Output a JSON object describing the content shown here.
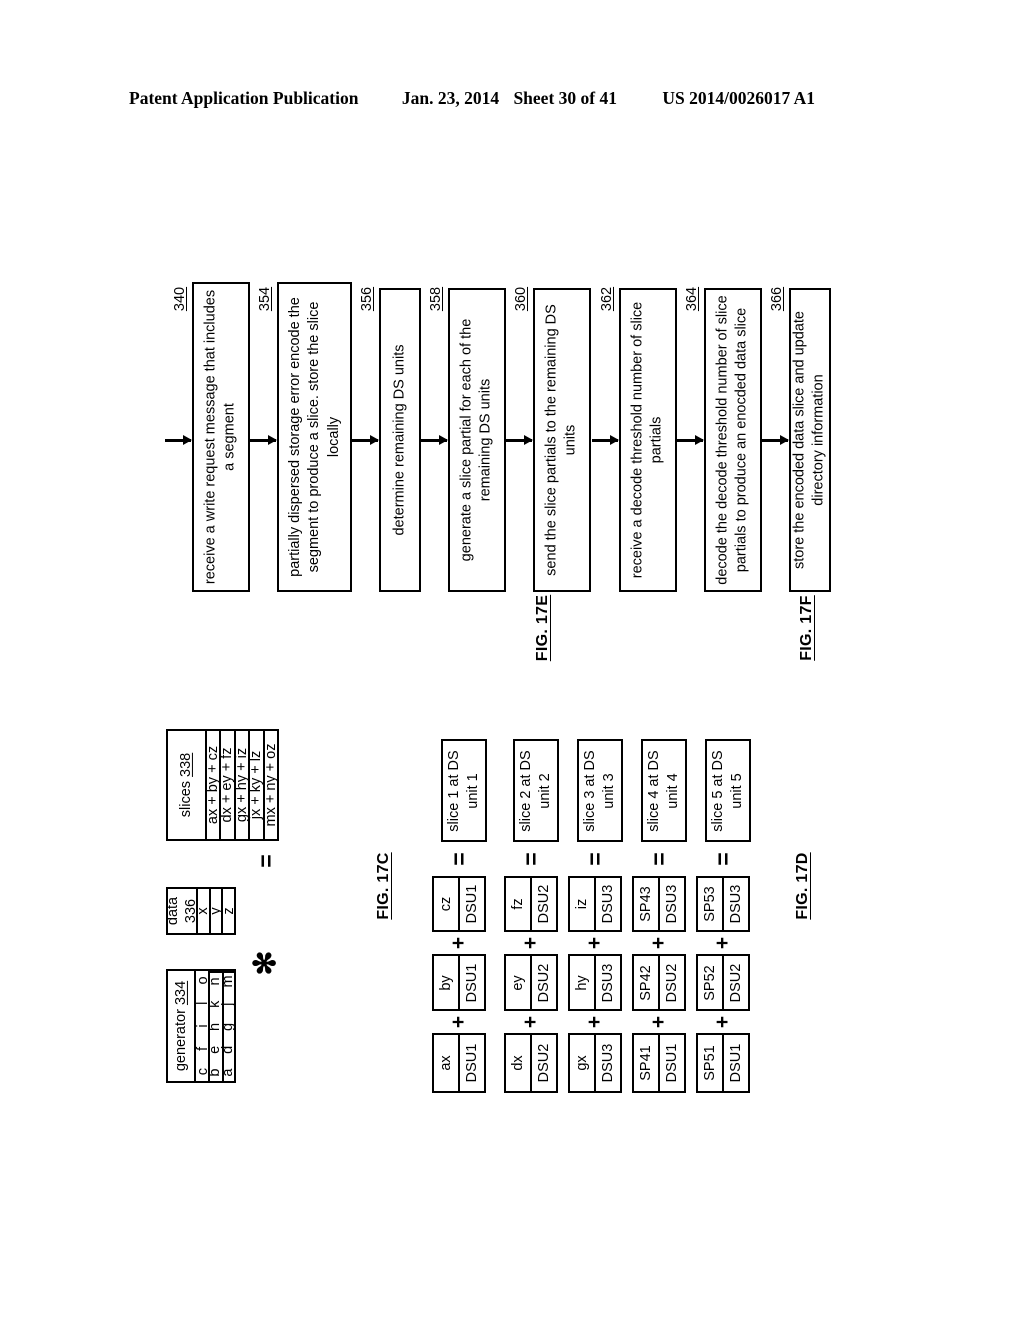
{
  "header": {
    "publication": "Patent Application Publication",
    "date": "Jan. 23, 2014",
    "sheet": "Sheet 30 of 41",
    "patent_number": "US 2014/0026017 A1"
  },
  "fig17e": {
    "label": "FIG. 17E",
    "steps": [
      {
        "ref": "340",
        "text": "receive a write request message that includes a segment"
      },
      {
        "ref": "354",
        "text": "partially dispersed storage error encode the segment to produce a slice.  store the slice locally"
      },
      {
        "ref": "356",
        "text": "determine remaining DS units"
      },
      {
        "ref": "358",
        "text": "generate a slice partial for each of the remaining DS units"
      },
      {
        "ref": "360",
        "text": "send the slice partials to the remaining DS units"
      }
    ]
  },
  "fig17f": {
    "label": "FIG. 17F",
    "steps": [
      {
        "ref": "362",
        "text": "receive a decode threshold number of slice partials"
      },
      {
        "ref": "364",
        "text": "decode the decode threshold number of slice partials to produce an enocded data slice"
      },
      {
        "ref": "366",
        "text": "store the encoded data slice and update directory information"
      }
    ]
  },
  "fig17c": {
    "label": "FIG. 17C",
    "generator": {
      "title": "generator",
      "ref": "334",
      "rows": [
        [
          "a",
          "b",
          "c"
        ],
        [
          "d",
          "e",
          "f"
        ],
        [
          "g",
          "h",
          "i"
        ],
        [
          "j",
          "k",
          "l"
        ],
        [
          "m",
          "n",
          "o"
        ]
      ]
    },
    "operator_multiply": "✻",
    "data": {
      "title": "data",
      "ref": "336",
      "values": [
        "x",
        "y",
        "z"
      ]
    },
    "operator_equals": "=",
    "slices": {
      "title": "slices",
      "ref": "338",
      "values": [
        "ax + by + cz",
        "dx + ey + fz",
        "gx + hy + iz",
        "jx + ky + lz",
        "mx + ny + oz"
      ]
    }
  },
  "fig17d": {
    "label": "FIG. 17D",
    "operator_plus": "+",
    "operator_equals": "=",
    "rows": [
      {
        "terms": [
          {
            "value": "ax",
            "unit": "DSU1"
          },
          {
            "value": "by",
            "unit": "DSU1"
          },
          {
            "value": "cz",
            "unit": "DSU1"
          }
        ],
        "result": "slice 1 at DS unit 1"
      },
      {
        "terms": [
          {
            "value": "dx",
            "unit": "DSU2"
          },
          {
            "value": "ey",
            "unit": "DSU2"
          },
          {
            "value": "fz",
            "unit": "DSU2"
          }
        ],
        "result": "slice 2 at DS unit 2"
      },
      {
        "terms": [
          {
            "value": "gx",
            "unit": "DSU3"
          },
          {
            "value": "hy",
            "unit": "DSU3"
          },
          {
            "value": "iz",
            "unit": "DSU3"
          }
        ],
        "result": "slice 3 at DS unit 3"
      },
      {
        "terms": [
          {
            "value": "SP41",
            "unit": "DSU1"
          },
          {
            "value": "SP42",
            "unit": "DSU2"
          },
          {
            "value": "SP43",
            "unit": "DSU3"
          }
        ],
        "result": "slice 4 at DS unit 4"
      },
      {
        "terms": [
          {
            "value": "SP51",
            "unit": "DSU1"
          },
          {
            "value": "SP52",
            "unit": "DSU2"
          },
          {
            "value": "SP53",
            "unit": "DSU3"
          }
        ],
        "result": "slice 5 at DS unit 5"
      }
    ]
  }
}
